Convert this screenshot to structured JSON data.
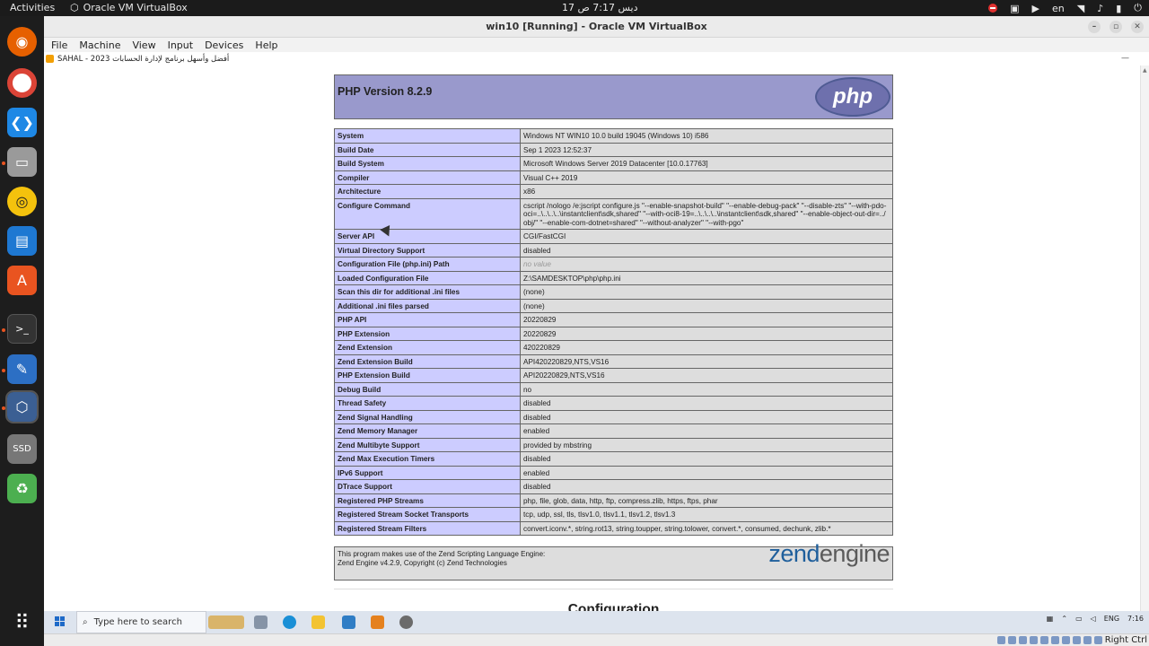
{
  "topbar": {
    "activities": "Activities",
    "app_name": "Oracle VM VirtualBox",
    "clock": "17 ديس  7:17 ص",
    "lang": "en"
  },
  "window": {
    "title": "win10 [Running] - Oracle VM VirtualBox",
    "menu": [
      "File",
      "Machine",
      "View",
      "Input",
      "Devices",
      "Help"
    ]
  },
  "guest": {
    "window_title": "SAHAL - 2023 أفضل وأسهل برنامج لإدارة الحسابات",
    "php_version": "PHP Version 8.2.9",
    "php_logo": "php",
    "rows": [
      {
        "k": "System",
        "v": "Windows NT WIN10 10.0 build 19045 (Windows 10) i586"
      },
      {
        "k": "Build Date",
        "v": "Sep 1 2023 12:52:37"
      },
      {
        "k": "Build System",
        "v": "Microsoft Windows Server 2019 Datacenter [10.0.17763]"
      },
      {
        "k": "Compiler",
        "v": "Visual C++ 2019"
      },
      {
        "k": "Architecture",
        "v": "x86"
      },
      {
        "k": "Configure Command",
        "v": "cscript /nologo /e:jscript configure.js \"--enable-snapshot-build\" \"--enable-debug-pack\" \"--disable-zts\" \"--with-pdo-oci=..\\..\\..\\..\\instantclient\\sdk,shared\" \"--with-oci8-19=..\\..\\..\\..\\instantclient\\sdk,shared\" \"--enable-object-out-dir=../obj/\" \"--enable-com-dotnet=shared\" \"--without-analyzer\" \"--with-pgo\""
      },
      {
        "k": "Server API",
        "v": "CGI/FastCGI"
      },
      {
        "k": "Virtual Directory Support",
        "v": "disabled"
      },
      {
        "k": "Configuration File (php.ini) Path",
        "v": "no value"
      },
      {
        "k": "Loaded Configuration File",
        "v": "Z:\\SAMDESKTOP\\php\\php.ini"
      },
      {
        "k": "Scan this dir for additional .ini files",
        "v": "(none)"
      },
      {
        "k": "Additional .ini files parsed",
        "v": "(none)"
      },
      {
        "k": "PHP API",
        "v": "20220829"
      },
      {
        "k": "PHP Extension",
        "v": "20220829"
      },
      {
        "k": "Zend Extension",
        "v": "420220829"
      },
      {
        "k": "Zend Extension Build",
        "v": "API420220829,NTS,VS16"
      },
      {
        "k": "PHP Extension Build",
        "v": "API20220829,NTS,VS16"
      },
      {
        "k": "Debug Build",
        "v": "no"
      },
      {
        "k": "Thread Safety",
        "v": "disabled"
      },
      {
        "k": "Zend Signal Handling",
        "v": "disabled"
      },
      {
        "k": "Zend Memory Manager",
        "v": "enabled"
      },
      {
        "k": "Zend Multibyte Support",
        "v": "provided by mbstring"
      },
      {
        "k": "Zend Max Execution Timers",
        "v": "disabled"
      },
      {
        "k": "IPv6 Support",
        "v": "enabled"
      },
      {
        "k": "DTrace Support",
        "v": "disabled"
      },
      {
        "k": "Registered PHP Streams",
        "v": "php, file, glob, data, http, ftp, compress.zlib, https, ftps, phar"
      },
      {
        "k": "Registered Stream Socket Transports",
        "v": "tcp, udp, ssl, tls, tlsv1.0, tlsv1.1, tlsv1.2, tlsv1.3"
      },
      {
        "k": "Registered Stream Filters",
        "v": "convert.iconv.*, string.rot13, string.toupper, string.tolower, convert.*, consumed, dechunk, zlib.*"
      }
    ],
    "zend_line1": "This program makes use of the Zend Scripting Language Engine:",
    "zend_line2": "Zend Engine v4.2.9, Copyright (c) Zend Technologies",
    "zend_logo_a": "zend",
    "zend_logo_b": "engine",
    "config_heading": "Configuration"
  },
  "taskbar": {
    "search_placeholder": "Type here to search",
    "lang": "ENG",
    "time": "7:16"
  },
  "status": {
    "host_key": "Right Ctrl"
  },
  "icons": [
    "firefox-icon",
    "chrome-icon",
    "vscode-icon",
    "files-icon",
    "rhythmbox-icon",
    "writer-icon",
    "app-center-icon",
    "terminal-icon",
    "text-editor-icon",
    "virtualbox-icon",
    "ssd-icon",
    "trash-icon",
    "app-grid-icon"
  ]
}
